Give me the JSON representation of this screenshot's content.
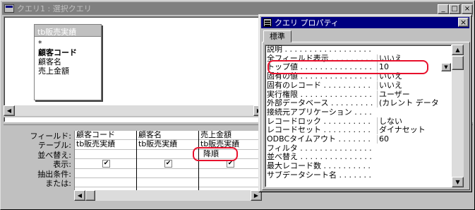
{
  "window": {
    "title": "クエリ1 : 選択クエリ"
  },
  "field_list": {
    "title": "tb販売実績",
    "fields": [
      "*",
      "顧客コード",
      "顧客名",
      "売上金額"
    ]
  },
  "grid": {
    "row_labels": [
      "フィールド:",
      "テーブル:",
      "並べ替え:",
      "表示:",
      "抽出条件:",
      "または:"
    ],
    "columns": [
      {
        "field": "顧客コード",
        "table": "tb販売実績",
        "sort": "",
        "show": true
      },
      {
        "field": "顧客名",
        "table": "tb販売実績",
        "sort": "",
        "show": true
      },
      {
        "field": "売上金額",
        "table": "tb販売実績",
        "sort": "降順",
        "show": true
      }
    ]
  },
  "props": {
    "title": "クエリ プロパティ",
    "tab": "標準",
    "rows": [
      {
        "name": "説明",
        "value": ""
      },
      {
        "name": "全フィールド表示",
        "value": "いいえ"
      },
      {
        "name": "トップ値",
        "value": "10"
      },
      {
        "name": "固有の値",
        "value": "いいえ"
      },
      {
        "name": "固有のレコード",
        "value": "いいえ"
      },
      {
        "name": "実行権限",
        "value": "ユーザー"
      },
      {
        "name": "外部データベース",
        "value": "(カレント データ"
      },
      {
        "name": "接続元アプリケーション",
        "value": ""
      },
      {
        "name": "レコードロック",
        "value": "しない"
      },
      {
        "name": "レコードセット",
        "value": "ダイナセット"
      },
      {
        "name": "ODBCタイムアウト",
        "value": "60"
      },
      {
        "name": "フィルタ",
        "value": ""
      },
      {
        "name": "並べ替え",
        "value": ""
      },
      {
        "name": "最大レコード数",
        "value": ""
      },
      {
        "name": "サブデータシート名",
        "value": ""
      }
    ]
  },
  "colors": {
    "highlight": "#e8102c",
    "active_title": "#000080",
    "inactive_title": "#808080"
  }
}
